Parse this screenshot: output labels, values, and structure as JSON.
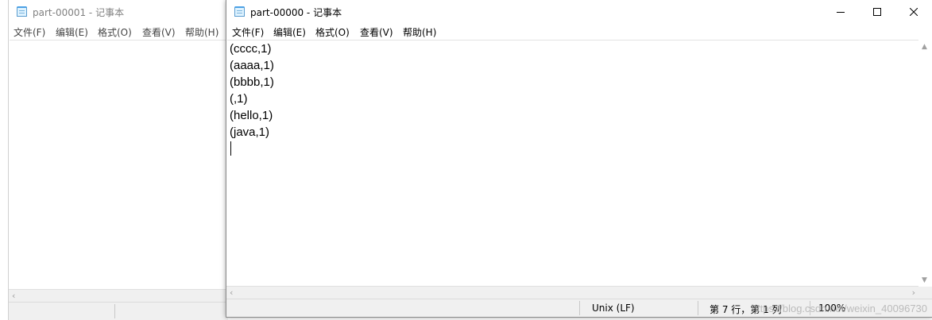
{
  "back_window": {
    "title": "part-00001 - 记事本",
    "menu": [
      "文件(F)",
      "编辑(E)",
      "格式(O)",
      "查看(V)",
      "帮助(H)"
    ]
  },
  "front_window": {
    "title": "part-00000 - 记事本",
    "menu": [
      "文件(F)",
      "编辑(E)",
      "格式(O)",
      "查看(V)",
      "帮助(H)"
    ],
    "lines": [
      "(cccc,1)",
      "(aaaa,1)",
      "(bbbb,1)",
      "(,1)",
      "(hello,1)",
      "(java,1)"
    ],
    "status": {
      "encoding": "Unix (LF)",
      "position": "第 7 行，第 1 列",
      "zoom": "100%"
    }
  },
  "watermark": "https://blog.csdn.net/weixin_40096730"
}
